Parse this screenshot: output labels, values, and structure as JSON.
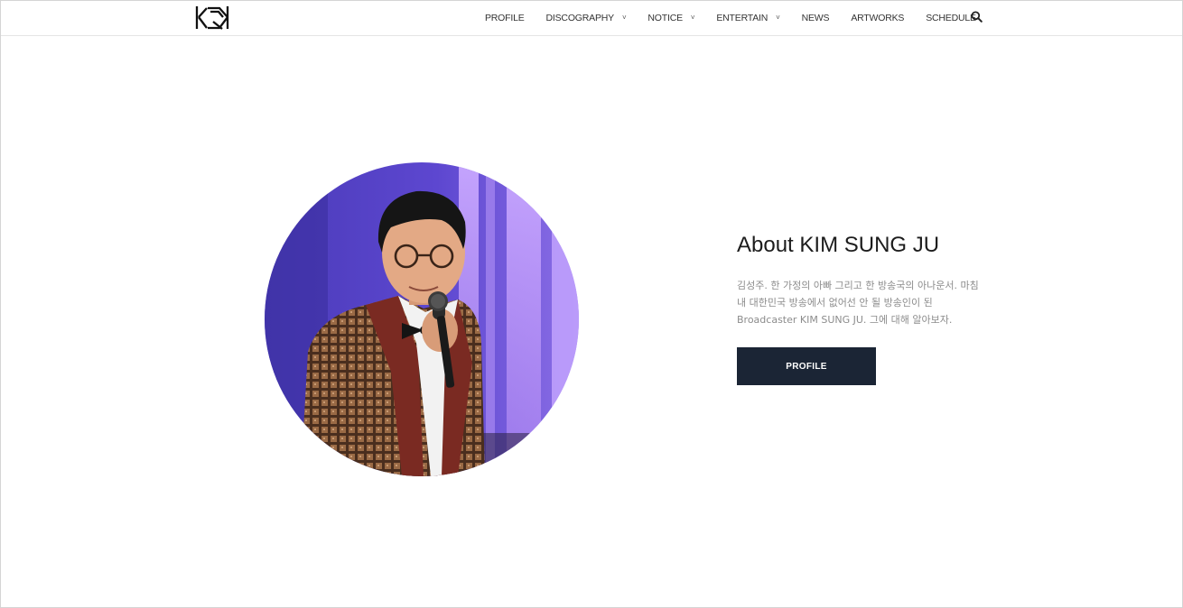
{
  "header": {
    "logo_icon": "kim-sung-ju-logo-icon",
    "nav": [
      {
        "label": "PROFILE",
        "has_dropdown": false
      },
      {
        "label": "DISCOGRAPHY",
        "has_dropdown": true
      },
      {
        "label": "NOTICE",
        "has_dropdown": true
      },
      {
        "label": "ENTERTAIN",
        "has_dropdown": true
      },
      {
        "label": "NEWS",
        "has_dropdown": false
      },
      {
        "label": "ARTWORKS",
        "has_dropdown": false
      },
      {
        "label": "SCHEDULE",
        "has_dropdown": false
      }
    ],
    "dropdown_caret": "˅",
    "search_icon": "search-icon"
  },
  "about": {
    "title": "About KIM SUNG JU",
    "description_lines": [
      "김성주. 한 가정의 아빠 그리고 한 방송국의 아나운서. 마침",
      "내 대한민국 방송에서 없어선 안 될 방송인이 된",
      "Broadcaster KIM SUNG JU. 그에 대해 알아보자."
    ],
    "button_label": "PROFILE"
  },
  "colors": {
    "button_bg": "#1b2535",
    "title_text": "#1c1c1c",
    "body_text": "#8c8c8c",
    "stage_purple": "#6a4fd8"
  }
}
